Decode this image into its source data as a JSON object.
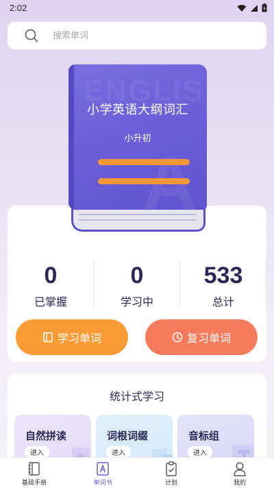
{
  "status_bar": {
    "time": "2:02"
  },
  "search": {
    "placeholder": "搜索单词"
  },
  "book": {
    "title": "小学英语大纲词汇",
    "subtitle": "小升初",
    "watermark": "ENGLIS",
    "watermark_letter": "A"
  },
  "stats": [
    {
      "value": "0",
      "label": "已掌握"
    },
    {
      "value": "0",
      "label": "学习中"
    },
    {
      "value": "533",
      "label": "总计"
    }
  ],
  "buttons": {
    "learn": "学习单词",
    "review": "复习单词"
  },
  "learning": {
    "title": "统计式学习",
    "modes": [
      {
        "title": "自然拼读",
        "enter": "进入"
      },
      {
        "title": "词根词缀",
        "enter": "进入"
      },
      {
        "title": "音标组",
        "enter": "进入"
      }
    ]
  },
  "nav": [
    {
      "label": "基础手册",
      "icon": "notebook-icon"
    },
    {
      "label": "单词书",
      "icon": "letter-a-book-icon"
    },
    {
      "label": "计划",
      "icon": "clipboard-check-icon"
    },
    {
      "label": "我的",
      "icon": "person-icon"
    }
  ],
  "colors": {
    "primary": "#6a5bd6",
    "learn_button": "#f99a35",
    "review_button": "#f47c5c",
    "text_dark": "#2b2856"
  }
}
